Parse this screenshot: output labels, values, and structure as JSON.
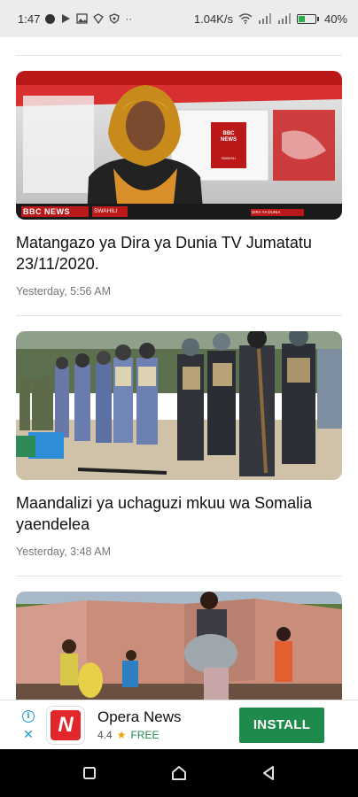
{
  "status_bar": {
    "time": "1:47",
    "network_speed": "1.04K/s",
    "battery_percent": "40%",
    "battery_level": 0.4
  },
  "articles": [
    {
      "title": "Matangazo ya Dira ya Dunia TV Jumatatu 23/11/2020.",
      "time": "Yesterday, 5:56 AM",
      "image_text": {
        "bbc_news": "BBC NEWS",
        "swahili": "SWAHILI",
        "bottom_left": "BBC NEWS",
        "bottom_left_sub": "SWAHILI",
        "bottom_right": "DIRA YA DUNIA"
      }
    },
    {
      "title": "Maandalizi ya uchaguzi mkuu wa Somalia yaendelea",
      "time": "Yesterday, 3:48 AM"
    },
    {
      "title": "",
      "time": ""
    }
  ],
  "ad": {
    "app_name": "Opera News",
    "rating": "4.4",
    "price": "FREE",
    "install_label": "INSTALL",
    "logo_letter": "N",
    "info_label": "i",
    "close_label": "✕"
  },
  "icons": {
    "status": [
      "notification-dot-icon",
      "play-icon",
      "image-icon",
      "vpn-icon",
      "shield-icon",
      "more-icon",
      "wifi-icon",
      "signal-icon",
      "battery-icon"
    ],
    "nav": [
      "recents-icon",
      "home-icon",
      "back-icon"
    ]
  },
  "colors": {
    "install_button": "#1e8a4c",
    "opera_red": "#e3262c",
    "ad_info_blue": "#1a9bdb",
    "bbc_red": "#bb1919"
  }
}
